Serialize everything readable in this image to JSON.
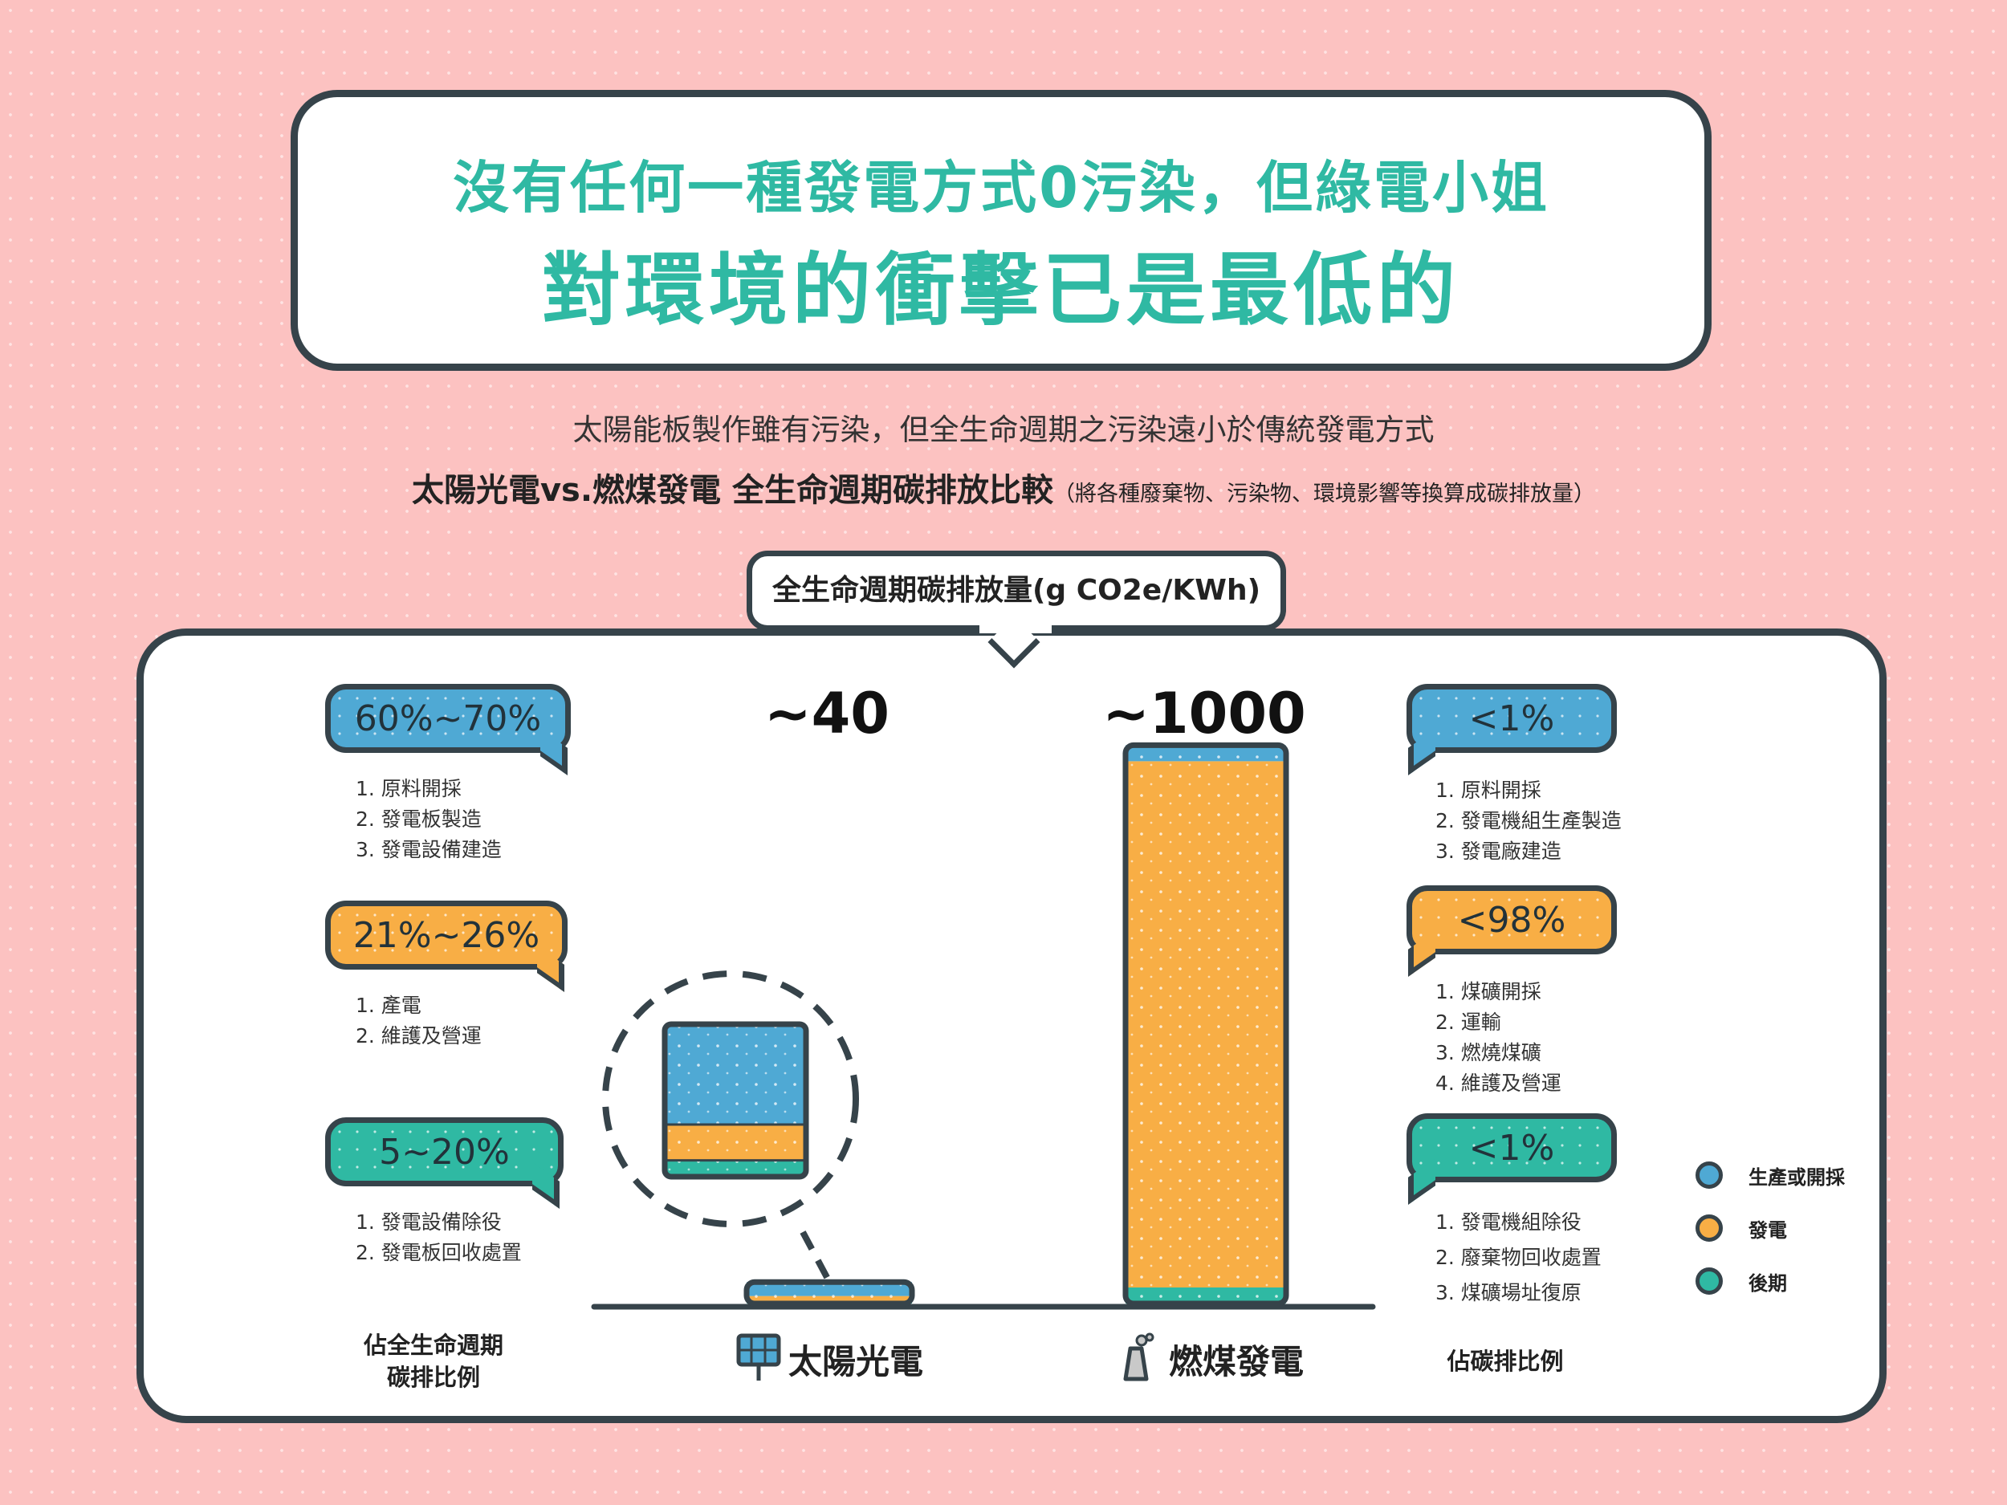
{
  "header": {
    "title_line1": "沒有任何一種發電方式0污染，但綠電小姐",
    "title_line2": "對環境的衝擊已是最低的"
  },
  "subtitle": {
    "line1": "太陽能板製作雖有污染，但全生命週期之污染遠小於傳統發電方式",
    "line2_main": "太陽光電vs.燃煤發電 全生命週期碳排放比較",
    "line2_note": "（將各種廢棄物、污染物、環境影響等換算成碳排放量）"
  },
  "unit_label": "全生命週期碳排放量(g CO2e/KWh)",
  "left_panel": {
    "footer": [
      "佔全生命週期",
      "碳排比例"
    ],
    "groups": [
      {
        "badge": "60%~70%",
        "items": [
          "1. 原料開採",
          "2. 發電板製造",
          "3. 發電設備建造"
        ]
      },
      {
        "badge": "21%~26%",
        "items": [
          "1. 產電",
          "2. 維護及營運"
        ]
      },
      {
        "badge": "5~20%",
        "items": [
          "1. 發電設備除役",
          "2. 發電板回收處置"
        ]
      }
    ]
  },
  "right_panel": {
    "footer": "佔碳排比例",
    "groups": [
      {
        "badge": "<1%",
        "items": [
          "1. 原料開採",
          "2. 發電機組生產製造",
          "3. 發電廠建造"
        ]
      },
      {
        "badge": "<98%",
        "items": [
          "1. 煤礦開採",
          "2. 運輸",
          "3. 燃燒煤礦",
          "4. 維護及營運"
        ]
      },
      {
        "badge": "<1%",
        "items": [
          "1. 發電機組除役",
          "2. 廢棄物回收處置",
          "3. 煤礦場址復原"
        ]
      }
    ]
  },
  "legend": {
    "items": [
      {
        "label": "生產或開採",
        "color": "#4fa9d4"
      },
      {
        "label": "發電",
        "color": "#f8ae45"
      },
      {
        "label": "後期",
        "color": "#2fb9a3"
      }
    ]
  },
  "colors": {
    "production": "#4fa9d4",
    "generation": "#f8ae45",
    "post": "#2fb9a3",
    "outline": "#36434a",
    "accent": "#2fb9a3",
    "background": "#fcc2c1"
  },
  "icons": {
    "solar": "solar-panel-icon",
    "coal": "coal-plant-icon"
  },
  "chart_data": {
    "type": "bar",
    "categories": [
      "太陽光電",
      "燃煤發電"
    ],
    "values": [
      40,
      1000
    ],
    "value_labels": [
      "~40",
      "~1000"
    ],
    "ylabel": "全生命週期碳排放量(g CO2e/KWh)",
    "ylim": [
      0,
      1000
    ],
    "stack_segments": [
      {
        "category": "太陽光電",
        "production_pct": 65,
        "generation_pct": 23.5,
        "post_pct": 11.5
      },
      {
        "category": "燃煤發電",
        "production_pct": 1,
        "generation_pct": 98,
        "post_pct": 1
      }
    ]
  }
}
